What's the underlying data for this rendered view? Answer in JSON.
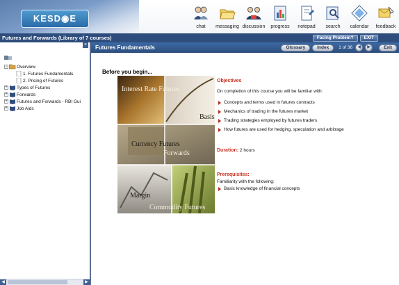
{
  "header": {
    "logo_text": "KESD◉E",
    "tools": [
      {
        "icon": "chat-icon",
        "label": "chat"
      },
      {
        "icon": "messaging-icon",
        "label": "messaging"
      },
      {
        "icon": "discussion-icon",
        "label": "discussion"
      },
      {
        "icon": "progress-icon",
        "label": "progress"
      },
      {
        "icon": "notepad-icon",
        "label": "notepad"
      },
      {
        "icon": "search-icon",
        "label": "search"
      },
      {
        "icon": "calendar-icon",
        "label": "calendar"
      },
      {
        "icon": "feedback-icon",
        "label": "feedback"
      }
    ]
  },
  "course_bar": {
    "title": "Futures and Forwards (Library of 7 courses)",
    "facing_problem": "Facing Problem?",
    "exit": "EXIT"
  },
  "tree": {
    "items": [
      {
        "label": "Overview",
        "expander": "−"
      },
      {
        "label": "1. Futures Fundamentals"
      },
      {
        "label": "2. Pricing of Futures"
      },
      {
        "label": "Types of Futures",
        "expander": "+"
      },
      {
        "label": "Forwards",
        "expander": "+"
      },
      {
        "label": "Futures and Forwards - RBI Gui",
        "expander": "+"
      },
      {
        "label": "Job Aids",
        "expander": "+"
      }
    ]
  },
  "content": {
    "title": "Futures Fundamentals",
    "glossary": "Glossary",
    "index": "Index",
    "page_counter": "1 of 36",
    "exit": "Exit",
    "before_heading": "Before you begin...",
    "collage_labels": {
      "interest_rate_futures": "Interest Rate Futures",
      "basis": "Basis",
      "currency_futures": "Currency Futures",
      "forwards": "Forwards",
      "margin": "Margin",
      "commodity_futures": "Commodity Futures"
    },
    "objectives": {
      "title": "Objectives",
      "intro": "On completion of this course you will be familiar with:",
      "items": [
        "Concepts and terms used in futures contracts",
        "Mechanics of trading in the futures market",
        "Trading strategies employed by futures traders",
        "How futures are used for hedging, speculation and arbitrage"
      ]
    },
    "duration": {
      "label": "Duration:",
      "value": "2 hours"
    },
    "prerequisites": {
      "title": "Prerequisites:",
      "intro": "Familiarity with the following:",
      "items": [
        "Basic knowledge of financial concepts"
      ]
    }
  },
  "colors": {
    "dark_blue": "#2e4d7c",
    "accent_red": "#c8301f",
    "panel_border": "#5a6f92"
  }
}
